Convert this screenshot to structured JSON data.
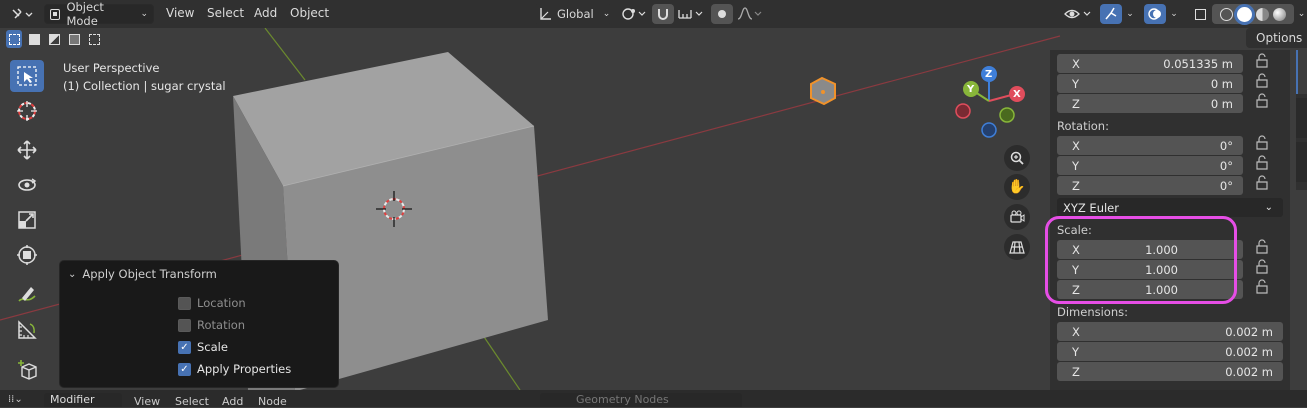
{
  "header": {
    "mode": "Object Mode",
    "menus": [
      "View",
      "Select",
      "Add",
      "Object"
    ],
    "orientation": "Global",
    "options_label": "Options"
  },
  "viewport": {
    "perspective": "User Perspective",
    "collection": "(1) Collection | sugar crystal",
    "gizmo_axes": [
      "X",
      "Y",
      "Z"
    ]
  },
  "apply_panel": {
    "title": "Apply Object Transform",
    "options": [
      {
        "label": "Location",
        "checked": false
      },
      {
        "label": "Rotation",
        "checked": false
      },
      {
        "label": "Scale",
        "checked": true
      },
      {
        "label": "Apply Properties",
        "checked": true
      }
    ]
  },
  "properties": {
    "location": [
      {
        "axis": "X",
        "value": "0.051335 m"
      },
      {
        "axis": "Y",
        "value": "0 m"
      },
      {
        "axis": "Z",
        "value": "0 m"
      }
    ],
    "rotation_label": "Rotation:",
    "rotation": [
      {
        "axis": "X",
        "value": "0°"
      },
      {
        "axis": "Y",
        "value": "0°"
      },
      {
        "axis": "Z",
        "value": "0°"
      }
    ],
    "rotation_mode": "XYZ Euler",
    "scale_label": "Scale:",
    "scale": [
      {
        "axis": "X",
        "value": "1.000"
      },
      {
        "axis": "Y",
        "value": "1.000"
      },
      {
        "axis": "Z",
        "value": "1.000"
      }
    ],
    "dimensions_label": "Dimensions:",
    "dimensions": [
      {
        "axis": "X",
        "value": "0.002 m"
      },
      {
        "axis": "Y",
        "value": "0.002 m"
      },
      {
        "axis": "Z",
        "value": "0.002 m"
      }
    ]
  },
  "bottom_bar": {
    "editor": "Modifier",
    "menus": [
      "View",
      "Select",
      "Add",
      "Node"
    ],
    "node_tree": "Geometry Nodes"
  },
  "colors": {
    "highlight": "#e64ee6",
    "accent": "#4772b3",
    "axis_x": "#e04d5c",
    "axis_y": "#88b63a",
    "axis_z": "#3f7fd9"
  }
}
